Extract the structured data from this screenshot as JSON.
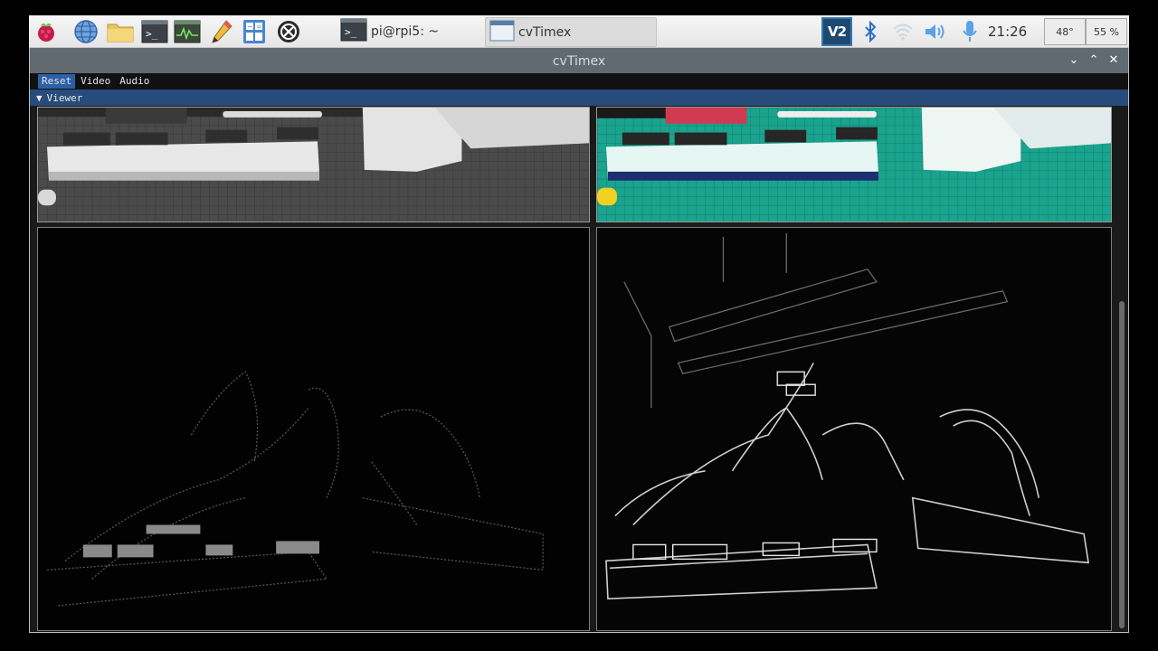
{
  "taskbar": {
    "launchers": [
      {
        "name": "raspberry-menu-icon"
      },
      {
        "name": "web-browser-icon"
      },
      {
        "name": "file-manager-icon"
      },
      {
        "name": "terminal-icon"
      },
      {
        "name": "task-manager-icon"
      },
      {
        "name": "text-editor-icon"
      },
      {
        "name": "calculator-icon"
      },
      {
        "name": "raspberry-pi-connect-icon"
      }
    ],
    "tasks": [
      {
        "label": "pi@rpi5: ~",
        "icon": "terminal-icon"
      },
      {
        "label": "cvTimex",
        "icon": "window-icon",
        "active": true
      }
    ],
    "tray": {
      "vnc_label": "V2",
      "clock": "21:26",
      "cpu_temp": "48°",
      "cpu_usage": "55 %"
    }
  },
  "window": {
    "title": "cvTimex",
    "controls": {
      "minimize": "⌄",
      "maximize": "⌃",
      "close": "✕"
    },
    "menu": [
      {
        "label": "Reset",
        "active": true
      },
      {
        "label": "Video"
      },
      {
        "label": "Audio"
      }
    ],
    "viewer": {
      "arrow": "▼",
      "label": "Viewer"
    },
    "panes": [
      {
        "name": "grayscale-feed",
        "kind": "camera grayscale"
      },
      {
        "name": "color-feed",
        "kind": "camera color"
      },
      {
        "name": "motion-diff-feed",
        "kind": "frame difference"
      },
      {
        "name": "edge-detection-feed",
        "kind": "edge detection"
      }
    ]
  },
  "colors": {
    "titlebar": "#606a70",
    "menubar": "#111111",
    "viewer_header": "#274b7a",
    "active_menu": "#2c5fa5",
    "mat_color": "#1aa38e"
  }
}
